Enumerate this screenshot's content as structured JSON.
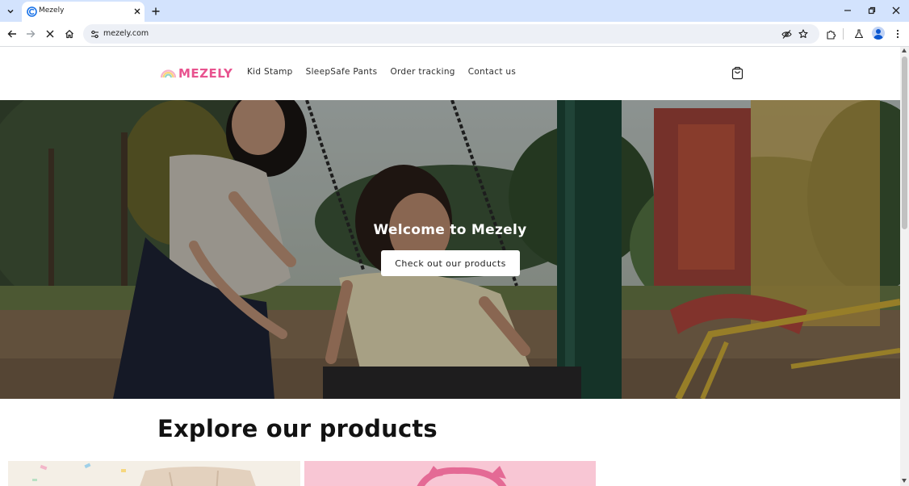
{
  "browser": {
    "tab": {
      "title": "Mezely"
    },
    "address_bar": {
      "url": "mezely.com"
    },
    "icons": {
      "tab_list": "chevron-down-icon",
      "tab_close": "close-icon",
      "new_tab": "plus-icon",
      "back": "back-arrow-icon",
      "forward": "forward-arrow-icon",
      "stop": "stop-loading-icon",
      "home": "home-icon",
      "site_info": "tune-icon",
      "eye": "eye-off-icon",
      "bookmark": "star-icon",
      "extensions": "puzzle-icon",
      "labs": "flask-icon",
      "menu": "kebab-menu-icon",
      "minimize": "minimize-icon",
      "restore": "restore-icon",
      "close_window": "close-icon"
    }
  },
  "site": {
    "logo_text": "MEZELY",
    "nav": [
      {
        "label": "Kid Stamp"
      },
      {
        "label": "SleepSafe Pants"
      },
      {
        "label": "Order tracking"
      },
      {
        "label": "Contact us"
      }
    ],
    "cart_icon": "shopping-bag-icon"
  },
  "hero": {
    "title": "Welcome to Mezely",
    "cta_label": "Check out our products"
  },
  "products": {
    "section_title": "Explore our products"
  },
  "colors": {
    "brand_pink": "#e8538f",
    "tab_strip": "#d3e3fd",
    "omnibox": "#edf0f6"
  }
}
